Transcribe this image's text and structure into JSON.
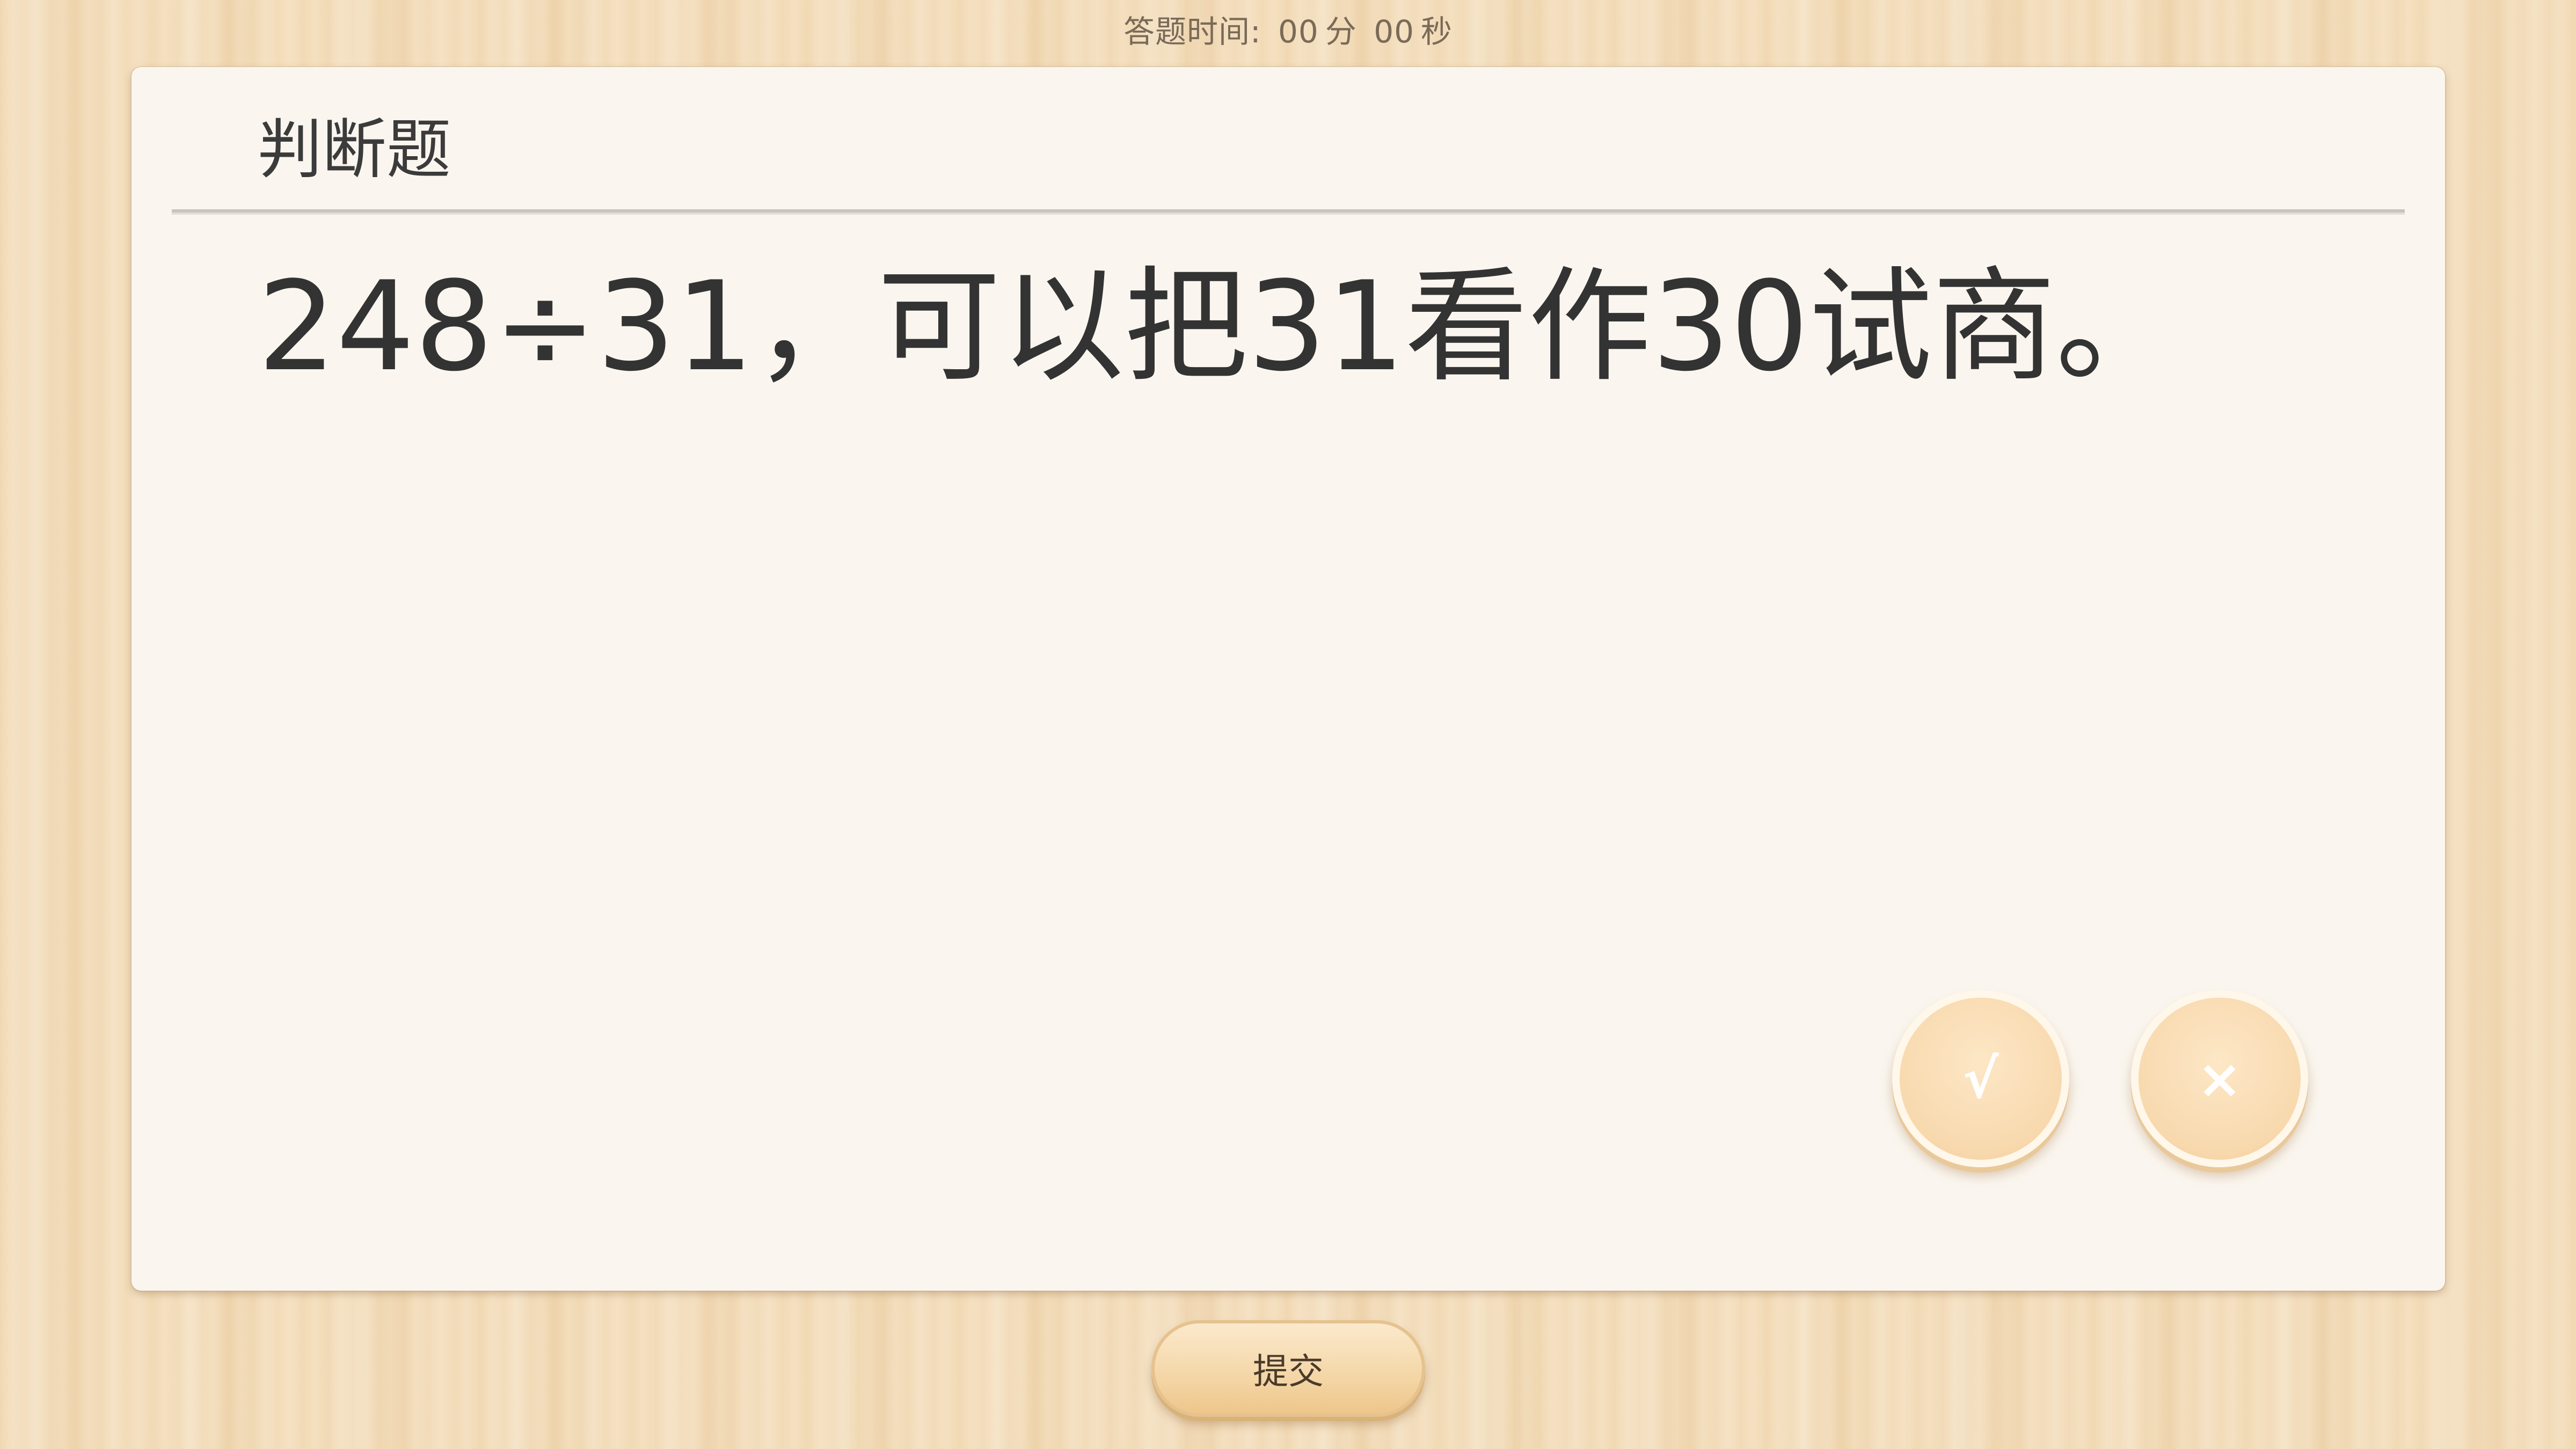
{
  "timer": {
    "label": "答题时间:",
    "minutes": "00",
    "minutes_unit": "分",
    "seconds": "00",
    "seconds_unit": "秒"
  },
  "card": {
    "title": "判断题",
    "question": "248÷31，可以把31看作30试商。"
  },
  "answers": {
    "true_symbol": "√",
    "false_symbol": "×"
  },
  "submit": {
    "label": "提交"
  }
}
